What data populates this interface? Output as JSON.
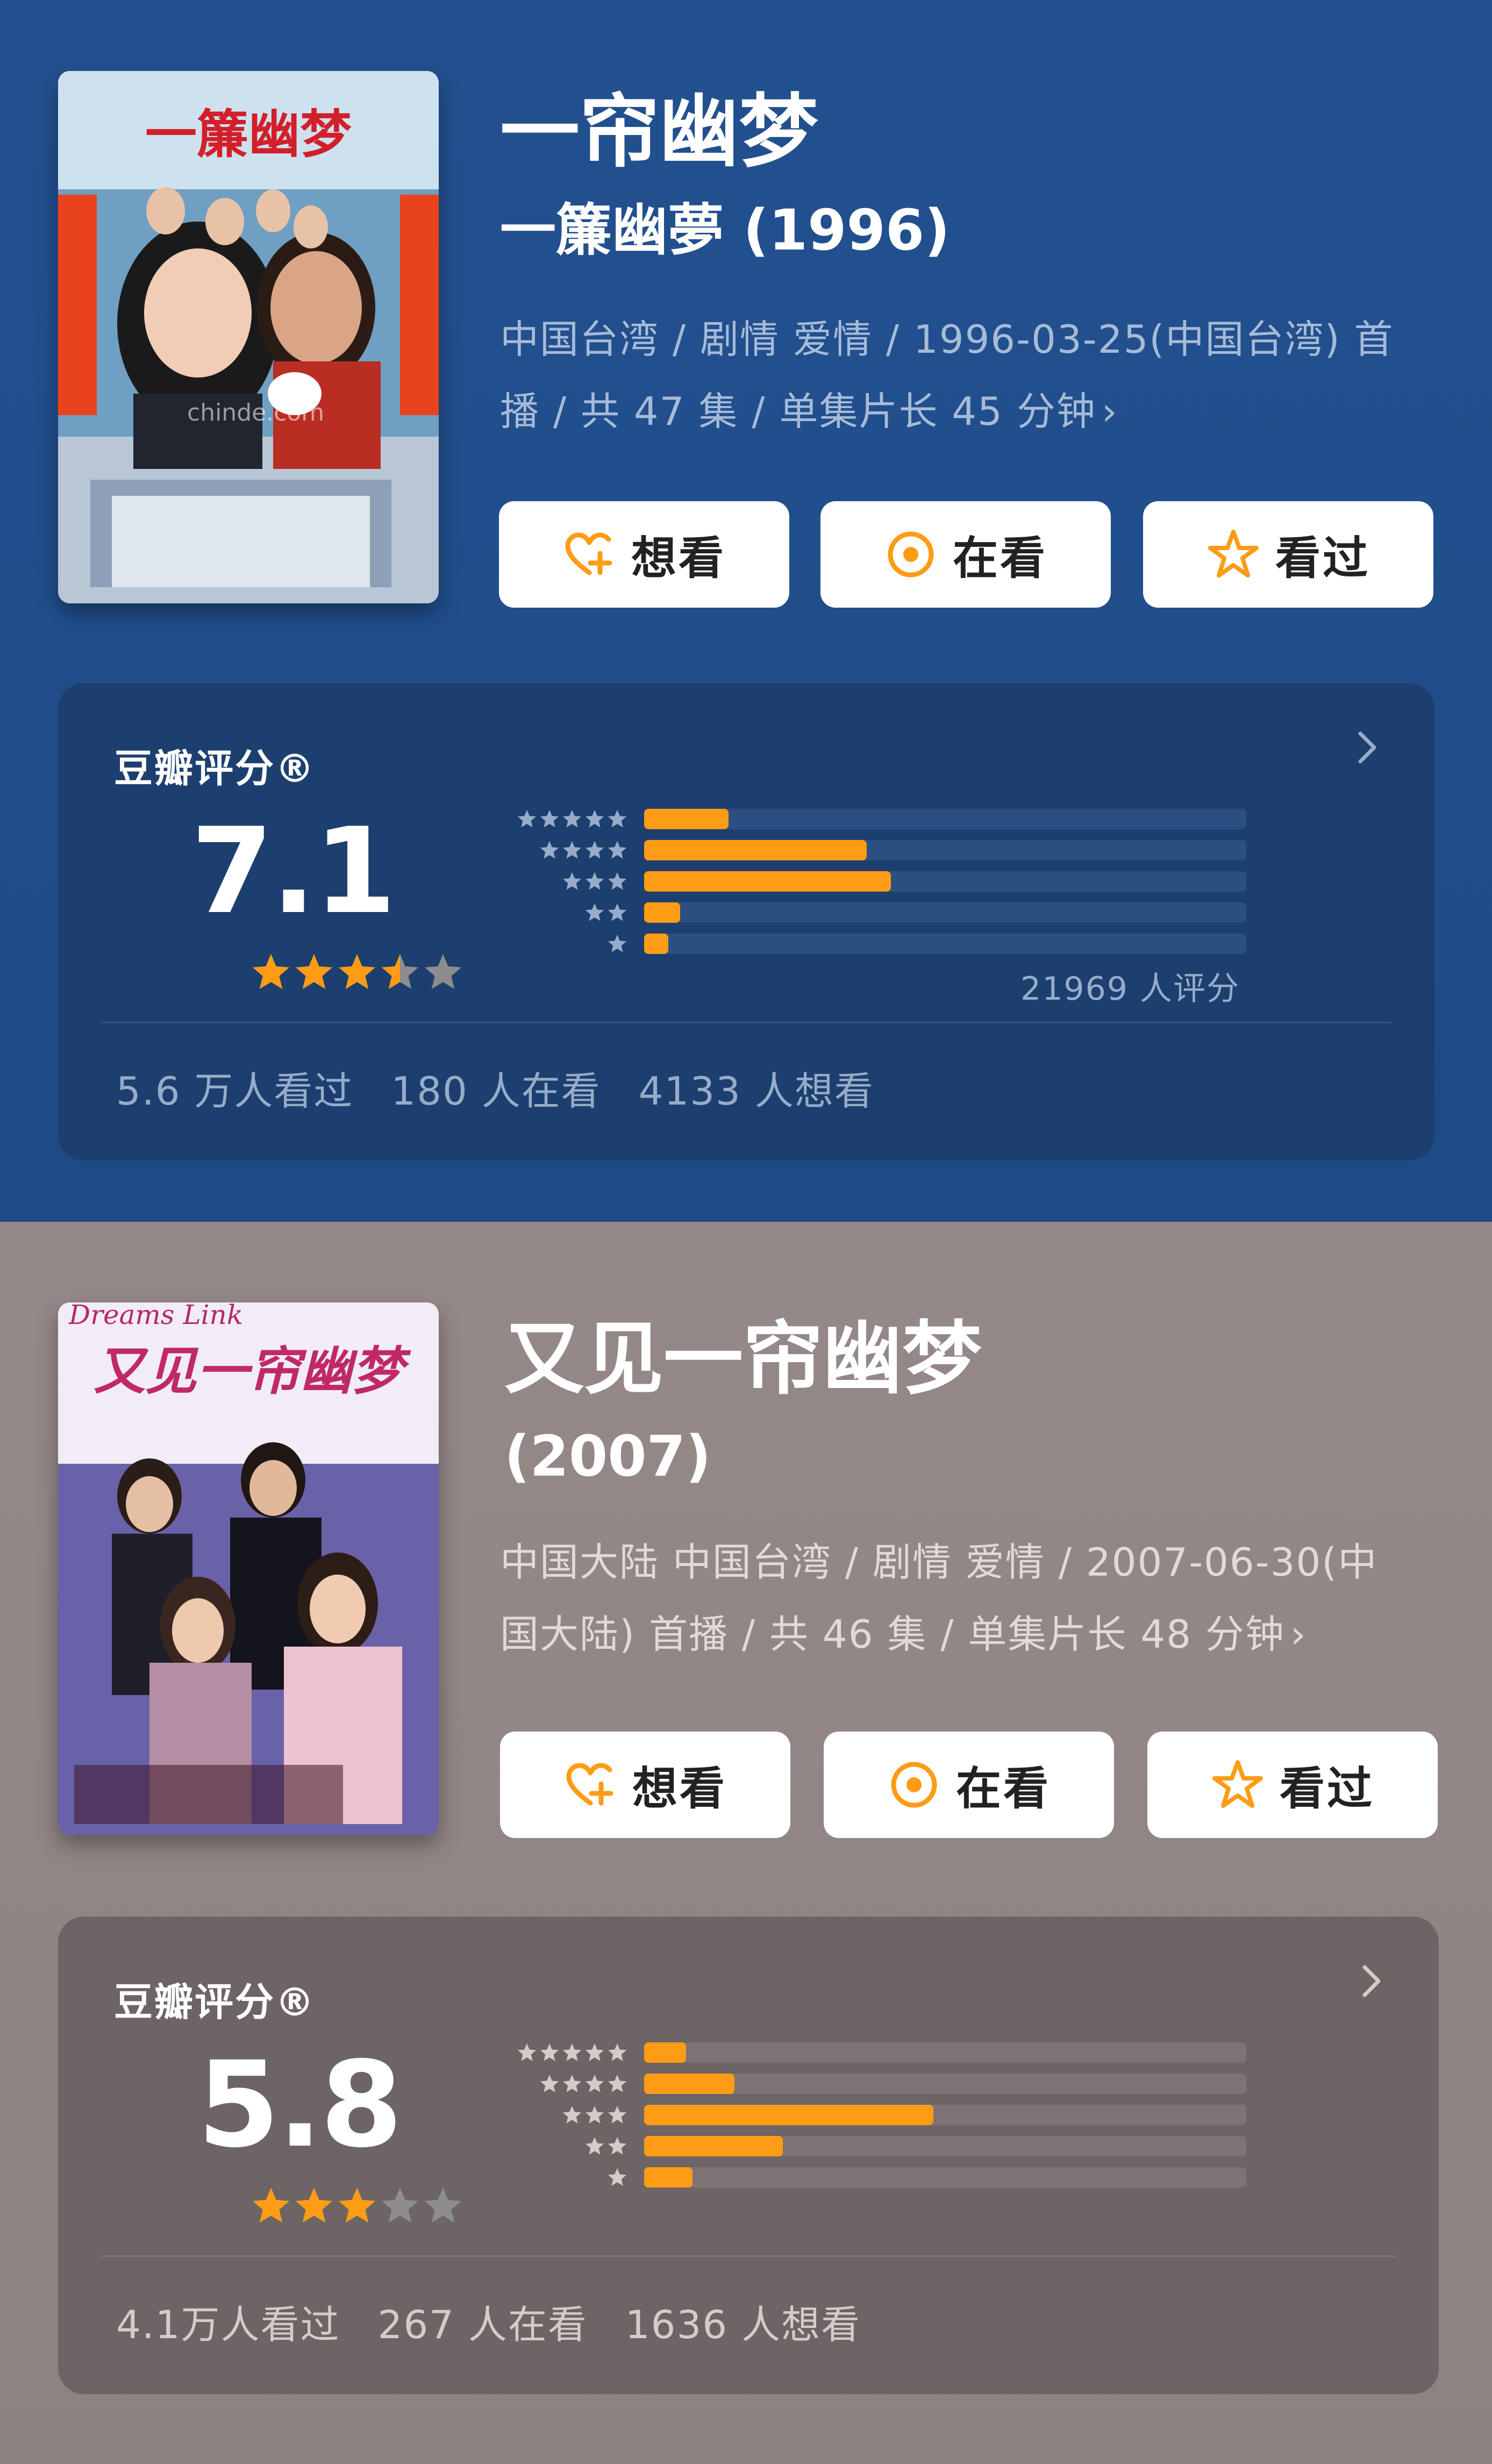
{
  "shows": [
    {
      "theme": {
        "meta_color": "#a6bbd8",
        "card_bg": "#1c3f6f",
        "track_color": "#2a4f80",
        "muted_color": "#96acc9",
        "divider_color": "#2d5589"
      },
      "poster": {
        "title_text": "一簾幽梦",
        "watermark": "chinde.com"
      },
      "title": "一帘幽梦",
      "subtitle": "一簾幽夢 (1996)",
      "meta_line1": "中国台湾 / 剧情 爱情 / 1996-03-25(中国台湾) 首",
      "meta_line2": "播 / 共 47 集 / 单集片长 45 分钟",
      "buttons": {
        "want": "想看",
        "watching": "在看",
        "watched": "看过"
      },
      "rating_label": "豆瓣评分®",
      "score": "7.1",
      "stars_value": 3.5,
      "distribution": [
        {
          "stars": 5,
          "percent": 14
        },
        {
          "stars": 4,
          "percent": 37
        },
        {
          "stars": 3,
          "percent": 41
        },
        {
          "stars": 2,
          "percent": 6
        },
        {
          "stars": 1,
          "percent": 4
        }
      ],
      "rating_count": "21969 人评分",
      "stats": {
        "watched": "5.6 万人看过",
        "watching": "180 人在看",
        "wanted": "4133 人想看"
      }
    },
    {
      "theme": {
        "meta_color": "#e3d9d6",
        "card_bg": "#6c6465",
        "track_color": "#7c7474",
        "muted_color": "#d6cbc9",
        "divider_color": "#807778"
      },
      "poster": {
        "title_text": "又见一帘幽梦",
        "english_title": "Dreams Link"
      },
      "title": "又见一帘幽梦",
      "subtitle": "(2007)",
      "meta_line1": "中国大陆 中国台湾 / 剧情 爱情 / 2007-06-30(中",
      "meta_line2": "国大陆) 首播 / 共 46 集 / 单集片长 48 分钟",
      "buttons": {
        "want": "想看",
        "watching": "在看",
        "watched": "看过"
      },
      "rating_label": "豆瓣评分®",
      "score": "5.8",
      "stars_value": 3,
      "distribution": [
        {
          "stars": 5,
          "percent": 7
        },
        {
          "stars": 4,
          "percent": 15
        },
        {
          "stars": 3,
          "percent": 48
        },
        {
          "stars": 2,
          "percent": 23
        },
        {
          "stars": 1,
          "percent": 8
        }
      ],
      "rating_count": "",
      "stats": {
        "watched": "4.1万人看过",
        "watching": "267 人在看",
        "wanted": "1636 人想看"
      }
    }
  ],
  "icons": {
    "want": "heart-plus-icon",
    "watching": "target-circle-icon",
    "watched": "star-outline-icon",
    "chevron": "chevron-right-icon"
  },
  "accent_color": "#fe9c16",
  "star_empty_color": "#8d8d8d"
}
